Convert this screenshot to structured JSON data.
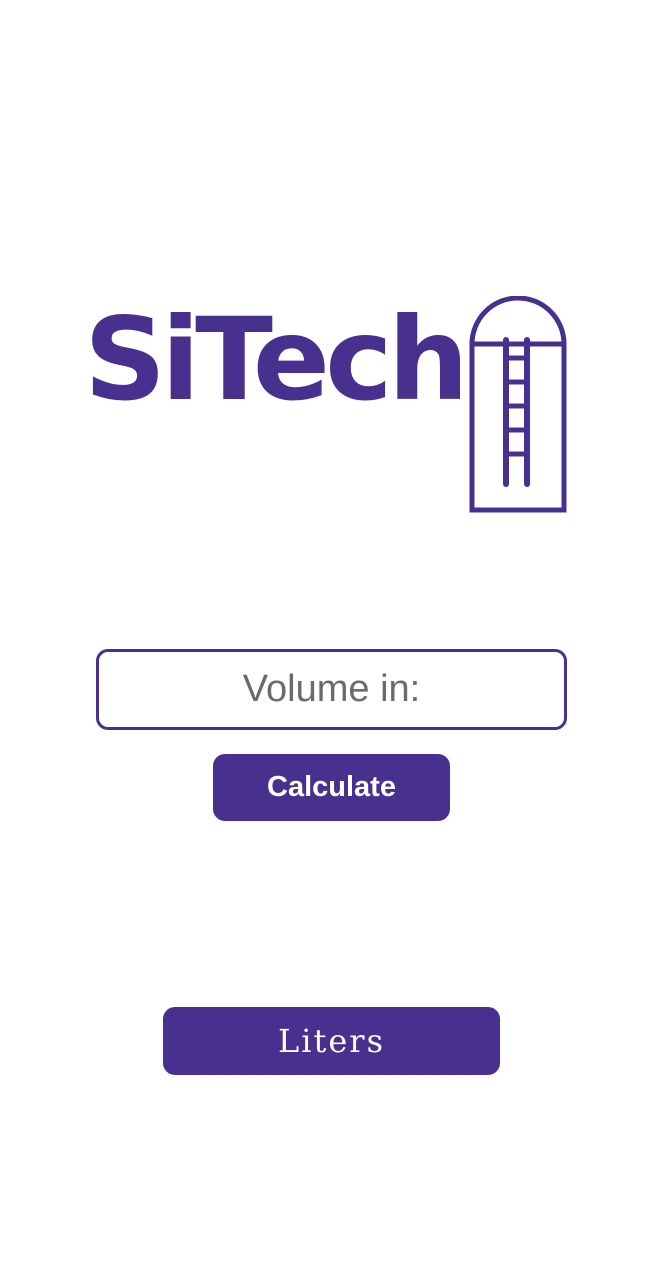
{
  "app": {
    "logo_text": "SiTech",
    "logo_icon": "silo-with-ladder-icon",
    "brand_color": "#48308f"
  },
  "form": {
    "volume_input": {
      "placeholder": "Volume in:",
      "value": ""
    },
    "calculate_label": "Calculate",
    "unit_label": "Liters"
  }
}
